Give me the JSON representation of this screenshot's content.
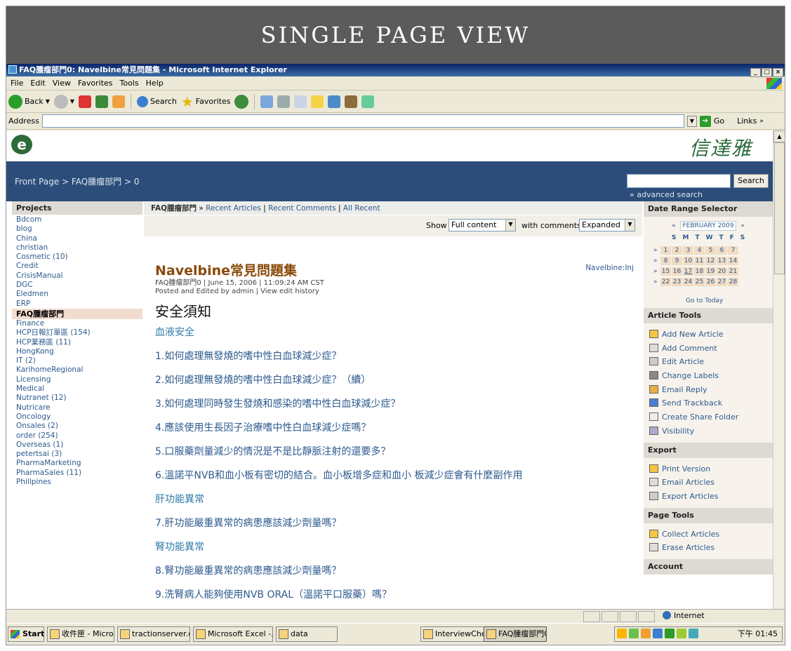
{
  "slide": {
    "title": "SINGLE PAGE VIEW"
  },
  "window": {
    "title": "FAQ腫瘤部門0: Navelbine常見問題集 - Microsoft Internet Explorer",
    "controls": [
      "_",
      "□",
      "×"
    ]
  },
  "menu": [
    "File",
    "Edit",
    "View",
    "Favorites",
    "Tools",
    "Help"
  ],
  "toolbar": {
    "back": "Back",
    "search": "Search",
    "favorites": "Favorites"
  },
  "address": {
    "label": "Address",
    "value": "",
    "go": "Go",
    "links": "Links"
  },
  "site": {
    "brand": "信達雅",
    "logo": "e",
    "breadcrumb": "Front Page > FAQ腫瘤部門 > 0",
    "search_button": "Search",
    "advanced_search": "» advanced search"
  },
  "projects": {
    "heading": "Projects",
    "items": [
      "Bdcom",
      "blog",
      "China",
      "christian",
      "Cosmetic (10)",
      "Credit",
      "CrisisManual",
      "DGC",
      "Eledmen",
      "ERP",
      "FAQ腫瘤部門",
      "Finance",
      "HCP日報訂單區 (154)",
      "HCP業務區 (11)",
      "HongKong",
      "IT (2)",
      "KarihomeRegional",
      "Licensing",
      "Medical",
      "Nutranet (12)",
      "Nutricare",
      "Oncology",
      "Onsales (2)",
      "order (254)",
      "Overseas (1)",
      "petertsai (3)",
      "PharmaMarketing",
      "PharmaSales (11)",
      "Phillpines"
    ],
    "current": "FAQ腫瘤部門"
  },
  "center": {
    "section": "FAQ腫瘤部門",
    "sep": "»",
    "links": [
      "Recent Articles",
      "Recent Comments",
      "All Recent"
    ],
    "show_label": "Show",
    "show_value": "Full content",
    "with_label": "with comments",
    "with_value": "Expanded"
  },
  "article": {
    "title": "Navelbine常見問題集",
    "tag": "Navelbine:Inj",
    "meta1": "FAQ腫瘤部門0 | June 15, 2006 | 11:09:24 AM CST",
    "meta2": "Posted and Edited by admin | View edit history",
    "section_title": "安全須知",
    "lines": [
      "血液安全",
      "1.如何處理無發燒的嗜中性白血球減少症？",
      "2.如何處理無發燒的嗜中性白血球減少症？（續）",
      "3.如何處理同時發生發燒和感染的嗜中性白血球減少症？",
      "4.應該使用生長因子治療嗜中性白血球減少症嗎？",
      "5.口服藥劑量減少的情況是不是比靜脈注射的還要多？",
      "6.溫諾平NVB和血小板有密切的結合。血小板增多症和血小 板減少症會有什麼副作用",
      "肝功能異常",
      "7.肝功能嚴重異常的病患應該減少劑量嗎？",
      "腎功能異常",
      "8.腎功能嚴重異常的病患應該減少劑量嗎？",
      "9.洗腎病人能夠使用NVB ORAL（溫諾平口服藥）嗎？"
    ]
  },
  "calendar": {
    "heading": "Date Range Selector",
    "month": "FEBRUARY 2009",
    "prev": "«",
    "next": "»",
    "days": "SMTWTFS",
    "week_marker": "»",
    "weeks": [
      [
        "1",
        "2",
        "3",
        "4",
        "5",
        "6",
        "7"
      ],
      [
        "8",
        "9",
        "10",
        "11",
        "12",
        "13",
        "14"
      ],
      [
        "15",
        "16",
        "17",
        "18",
        "19",
        "20",
        "21"
      ],
      [
        "22",
        "23",
        "24",
        "25",
        "26",
        "27",
        "28"
      ]
    ],
    "go_today": "Go to Today"
  },
  "article_tools": {
    "heading": "Article Tools",
    "items": [
      "Add New Article",
      "Add Comment",
      "Edit Article",
      "Change Labels",
      "Email Reply",
      "Send Trackback",
      "Create Share Folder",
      "Visibility"
    ]
  },
  "export": {
    "heading": "Export",
    "items": [
      "Print Version",
      "Email Articles",
      "Export Articles"
    ]
  },
  "page_tools": {
    "heading": "Page Tools",
    "items": [
      "Collect Articles",
      "Erase Articles"
    ]
  },
  "account": {
    "heading": "Account"
  },
  "status": {
    "zone": "Internet"
  },
  "taskbar": {
    "start": "Start",
    "tasks": [
      "收件匣 - Micros...",
      "tractionserver.c...",
      "Microsoft Excel -...",
      "data",
      "InterviewCheckli...",
      "FAQ腫瘤部門0:..."
    ],
    "clock": "下午 01:45"
  }
}
